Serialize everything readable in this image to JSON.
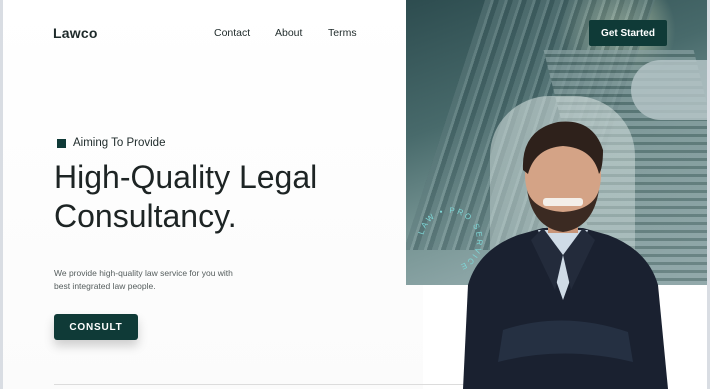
{
  "header": {
    "logo": "Lawco",
    "nav": [
      "Contact",
      "About",
      "Terms"
    ],
    "cta_label": "Get Started"
  },
  "hero": {
    "tagline": "Aiming To Provide",
    "headline_lines": [
      "High-Quality Legal",
      "Consultancy."
    ],
    "description_lines": [
      "We provide high-quality law service for you with",
      "best integrated law people."
    ],
    "button_label": "CONSULT",
    "badge_text": "LAW • PRO SERVICE"
  },
  "colors": {
    "accent": "#0f3a37",
    "badge_text": "#7ed6d6"
  }
}
